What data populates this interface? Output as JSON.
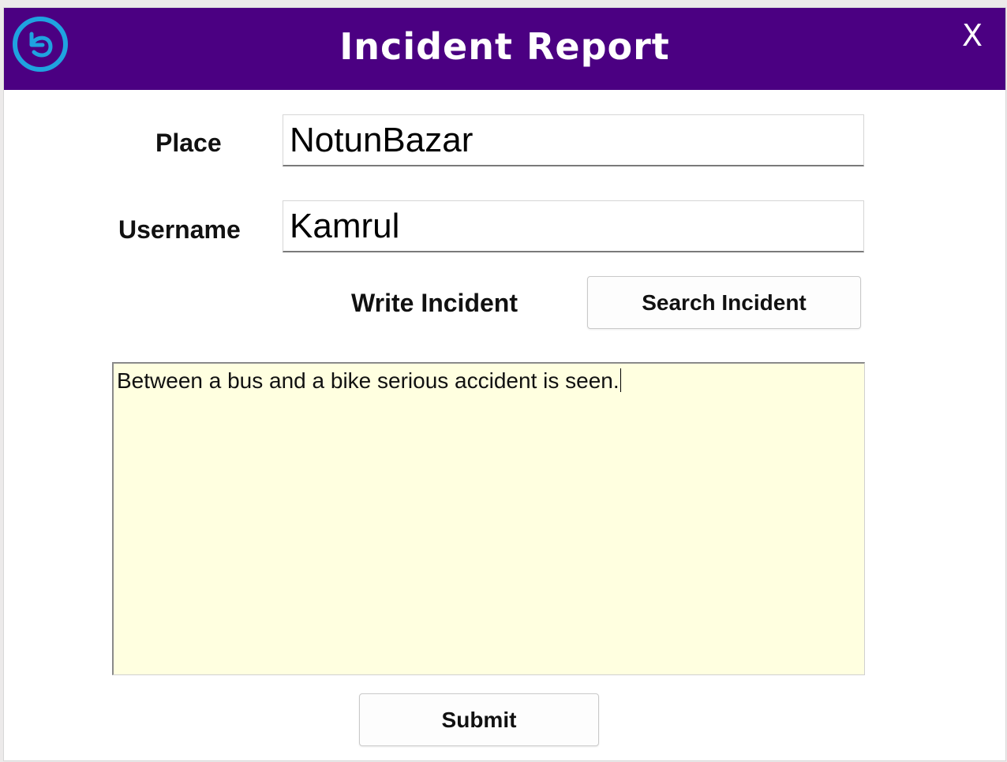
{
  "window": {
    "title": "Incident Report",
    "close_label": "X",
    "titlebar_color": "#4b0082",
    "back_icon": "back-arrow-circle-icon"
  },
  "form": {
    "place_label": "Place",
    "place_value": "NotunBazar",
    "username_label": "Username",
    "username_value": "Kamrul",
    "write_incident_label": "Write Incident",
    "search_button_label": "Search Incident",
    "incident_text": "Between a bus and a bike serious accident is seen.",
    "incident_bg_color": "#ffffe0",
    "submit_label": "Submit"
  }
}
